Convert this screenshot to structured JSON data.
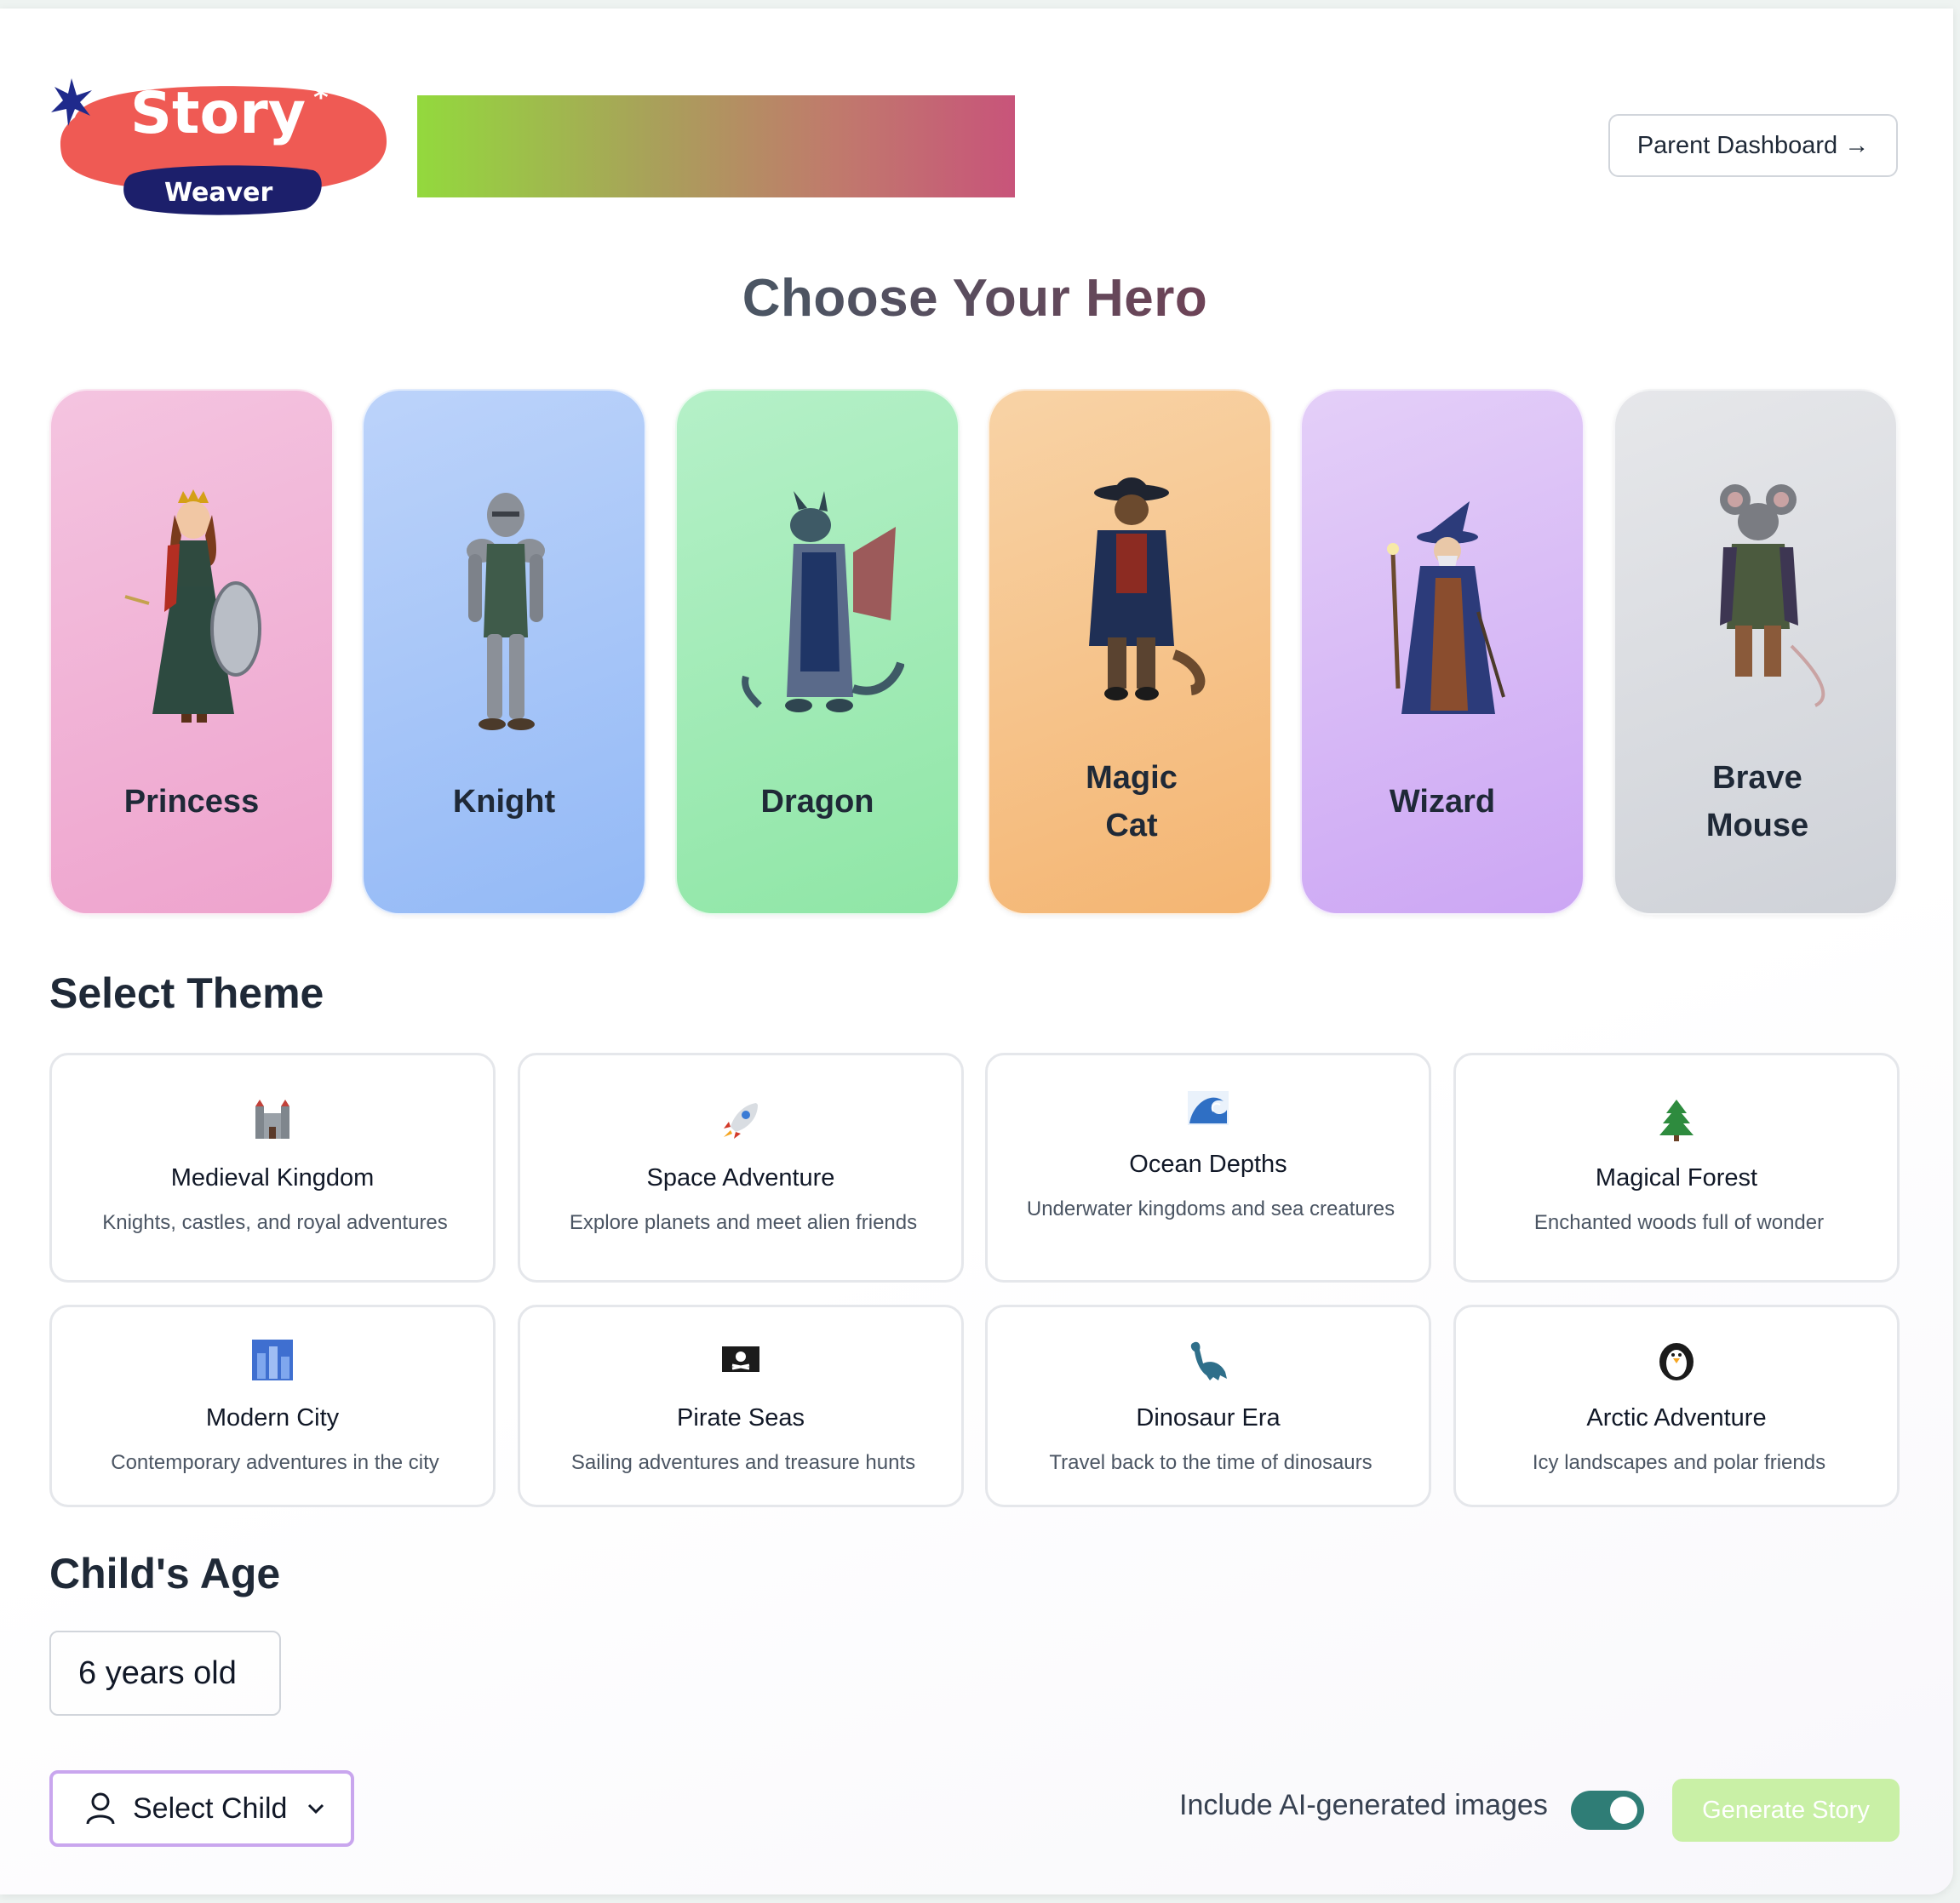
{
  "header": {
    "logo_text_top": "Story",
    "logo_text_bottom": "Weaver",
    "parent_dashboard_label": "Parent Dashboard",
    "parent_dashboard_arrow": "→"
  },
  "hero_section": {
    "title": "Choose Your Hero",
    "heroes": [
      {
        "label_line1": "Princess",
        "label_line2": "",
        "icon": "princess-icon",
        "gradient": [
          "#f4c4e0",
          "#eea3cd"
        ]
      },
      {
        "label_line1": "Knight",
        "label_line2": "",
        "icon": "knight-icon",
        "gradient": [
          "#bcd3fa",
          "#93b9f6"
        ]
      },
      {
        "label_line1": "Dragon",
        "label_line2": "",
        "icon": "dragon-icon",
        "gradient": [
          "#b5f0c8",
          "#8fe6a6"
        ]
      },
      {
        "label_line1": "Magic",
        "label_line2": "Cat",
        "icon": "cat-icon",
        "gradient": [
          "#f8d3a6",
          "#f4b572"
        ]
      },
      {
        "label_line1": "Wizard",
        "label_line2": "",
        "icon": "wizard-icon",
        "gradient": [
          "#e4cff8",
          "#cca6f4"
        ]
      },
      {
        "label_line1": "Brave",
        "label_line2": "Mouse",
        "icon": "mouse-icon",
        "gradient": [
          "#e6e7ea",
          "#cfd2d8"
        ]
      }
    ]
  },
  "theme_section": {
    "title": "Select Theme",
    "themes": [
      {
        "name": "Medieval Kingdom",
        "desc": "Knights, castles, and royal adventures",
        "icon": "castle-icon"
      },
      {
        "name": "Space Adventure",
        "desc": "Explore planets and meet alien friends",
        "icon": "rocket-icon"
      },
      {
        "name": "Ocean Depths",
        "desc": "Underwater kingdoms and sea creatures",
        "icon": "wave-icon"
      },
      {
        "name": "Magical Forest",
        "desc": "Enchanted woods full of wonder",
        "icon": "tree-icon"
      },
      {
        "name": "Modern City",
        "desc": "Contemporary adventures in the city",
        "icon": "city-icon"
      },
      {
        "name": "Pirate Seas",
        "desc": "Sailing adventures and treasure hunts",
        "icon": "pirate-flag-icon"
      },
      {
        "name": "Dinosaur Era",
        "desc": "Travel back to the time of dinosaurs",
        "icon": "dinosaur-icon"
      },
      {
        "name": "Arctic Adventure",
        "desc": "Icy landscapes and polar friends",
        "icon": "penguin-icon"
      }
    ]
  },
  "age_section": {
    "title": "Child's Age",
    "value": "6 years old"
  },
  "footer": {
    "select_child_label": "Select Child",
    "ai_images_label": "Include AI-generated images",
    "ai_images_enabled": true,
    "generate_label": "Generate Story"
  },
  "colors": {
    "logo_red": "#ef5a54",
    "logo_navy": "#1c1f6b",
    "toggle_on": "#2f7d76",
    "generate_disabled": "#c9f0a6"
  }
}
